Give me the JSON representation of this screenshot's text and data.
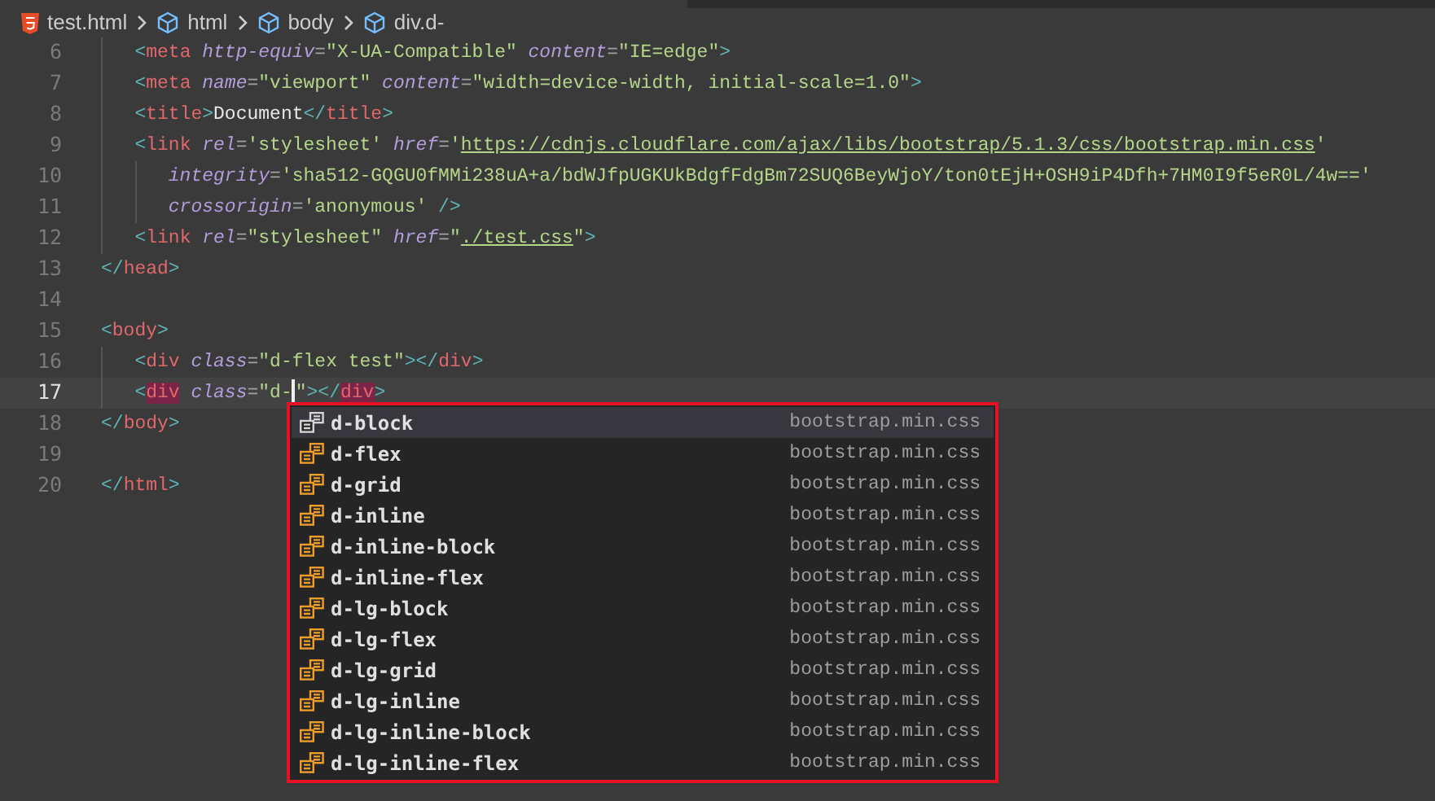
{
  "breadcrumb": [
    {
      "kind": "file",
      "label": "test.html"
    },
    {
      "kind": "element",
      "label": "html"
    },
    {
      "kind": "element",
      "label": "body"
    },
    {
      "kind": "element",
      "label": "div.d-"
    }
  ],
  "lines": [
    {
      "children": [
        {
          "number": "6",
          "current": false,
          "tokens": [
            {
              "kind": "bracket",
              "text": "<"
            },
            {
              "kind": "tag",
              "text": "meta"
            },
            {
              "kind": "attr",
              "text": " http-equiv"
            },
            {
              "kind": "eq",
              "text": "="
            },
            {
              "kind": "string",
              "text": "\"X-UA-Compatible\""
            },
            {
              "kind": "attr",
              "text": " content"
            },
            {
              "kind": "eq",
              "text": "="
            },
            {
              "kind": "string",
              "text": "\"IE=edge\""
            },
            {
              "kind": "bracket",
              "text": ">"
            }
          ]
        },
        {
          "number": "7",
          "current": false,
          "tokens": [
            {
              "kind": "bracket",
              "text": "<"
            },
            {
              "kind": "tag",
              "text": "meta"
            },
            {
              "kind": "attr",
              "text": " name"
            },
            {
              "kind": "eq",
              "text": "="
            },
            {
              "kind": "string",
              "text": "\"viewport\""
            },
            {
              "kind": "attr",
              "text": " content"
            },
            {
              "kind": "eq",
              "text": "="
            },
            {
              "kind": "string",
              "text": "\"width=device-width, initial-scale=1.0\""
            },
            {
              "kind": "bracket",
              "text": ">"
            }
          ]
        },
        {
          "number": "8",
          "current": false,
          "tokens": [
            {
              "kind": "bracket",
              "text": "<"
            },
            {
              "kind": "tag",
              "text": "title"
            },
            {
              "kind": "bracket",
              "text": ">"
            },
            {
              "kind": "text",
              "text": "Document"
            },
            {
              "kind": "bracket",
              "text": "</"
            },
            {
              "kind": "tag",
              "text": "title"
            },
            {
              "kind": "bracket",
              "text": ">"
            }
          ]
        },
        {
          "number": "9",
          "current": false,
          "tokens": [
            {
              "kind": "bracket",
              "text": "<"
            },
            {
              "kind": "tag",
              "text": "link"
            },
            {
              "kind": "attr",
              "text": " rel"
            },
            {
              "kind": "eq",
              "text": "="
            },
            {
              "kind": "string",
              "text": "'stylesheet'"
            },
            {
              "kind": "attr",
              "text": " href"
            },
            {
              "kind": "eq",
              "text": "="
            },
            {
              "kind": "string",
              "text": "'"
            },
            {
              "kind": "link",
              "text": "https://cdnjs.cloudflare.com/ajax/libs/bootstrap/5.1.3/css/bootstrap.min.css"
            },
            {
              "kind": "string",
              "text": "'"
            }
          ],
          "children": [
            {
              "number": "10",
              "current": false,
              "tokens": [
                {
                  "kind": "attr",
                  "text": "integrity"
                },
                {
                  "kind": "eq",
                  "text": "="
                },
                {
                  "kind": "string",
                  "text": "'sha512-GQGU0fMMi238uA+a/bdWJfpUGKUkBdgfFdgBm72SUQ6BeyWjoY/ton0tEjH+OSH9iP4Dfh+7HM0I9f5eR0L/4w=='"
                }
              ]
            },
            {
              "number": "11",
              "current": false,
              "tokens": [
                {
                  "kind": "attr",
                  "text": "crossorigin"
                },
                {
                  "kind": "eq",
                  "text": "="
                },
                {
                  "kind": "string",
                  "text": "'anonymous'"
                },
                {
                  "kind": "bracket",
                  "text": " />"
                }
              ]
            }
          ]
        },
        {
          "number": "12",
          "current": false,
          "tokens": [
            {
              "kind": "bracket",
              "text": "<"
            },
            {
              "kind": "tag",
              "text": "link"
            },
            {
              "kind": "attr",
              "text": " rel"
            },
            {
              "kind": "eq",
              "text": "="
            },
            {
              "kind": "string",
              "text": "\"stylesheet\""
            },
            {
              "kind": "attr",
              "text": " href"
            },
            {
              "kind": "eq",
              "text": "="
            },
            {
              "kind": "string",
              "text": "\""
            },
            {
              "kind": "link",
              "text": "./test.css"
            },
            {
              "kind": "string",
              "text": "\""
            },
            {
              "kind": "bracket",
              "text": ">"
            }
          ]
        }
      ]
    },
    {
      "number": "13",
      "current": false,
      "tokens": [
        {
          "kind": "bracket",
          "text": "</"
        },
        {
          "kind": "tag",
          "text": "head"
        },
        {
          "kind": "bracket",
          "text": ">"
        }
      ]
    },
    {
      "number": "14",
      "current": false
    },
    {
      "number": "15",
      "current": false,
      "tokens": [
        {
          "kind": "bracket",
          "text": "<"
        },
        {
          "kind": "tag",
          "text": "body"
        },
        {
          "kind": "bracket",
          "text": ">"
        }
      ],
      "children": [
        {
          "number": "16",
          "current": false,
          "tokens": [
            {
              "kind": "bracket",
              "text": "<"
            },
            {
              "kind": "tag",
              "text": "div"
            },
            {
              "kind": "attr",
              "text": " class"
            },
            {
              "kind": "eq",
              "text": "="
            },
            {
              "kind": "string",
              "text": "\"d-flex test\""
            },
            {
              "kind": "bracket",
              "text": "></"
            },
            {
              "kind": "tag",
              "text": "div"
            },
            {
              "kind": "bracket",
              "text": ">"
            }
          ]
        },
        {
          "number": "17",
          "current": true,
          "tokens": [
            {
              "kind": "bracket",
              "text": "<"
            },
            {
              "kind": "match",
              "text": "div"
            },
            {
              "kind": "attr",
              "text": " class"
            },
            {
              "kind": "eq",
              "text": "="
            },
            {
              "kind": "string",
              "text": "\"d-"
            },
            {
              "kind": "cursor"
            },
            {
              "kind": "string",
              "text": "\""
            },
            {
              "kind": "bracket",
              "text": "></"
            },
            {
              "kind": "match",
              "text": "div"
            },
            {
              "kind": "bracket",
              "text": ">"
            }
          ]
        }
      ]
    },
    {
      "number": "18",
      "current": false,
      "tokens": [
        {
          "kind": "bracket",
          "text": "</"
        },
        {
          "kind": "tag",
          "text": "body"
        },
        {
          "kind": "bracket",
          "text": ">"
        }
      ]
    },
    {
      "number": "19",
      "current": false
    },
    {
      "number": "20",
      "current": false,
      "tokens": [
        {
          "kind": "bracket",
          "text": "</"
        },
        {
          "kind": "tag",
          "text": "html"
        },
        {
          "kind": "bracket",
          "text": ">"
        }
      ]
    }
  ],
  "suggestions": [
    {
      "label": "d-block",
      "source": "bootstrap.min.css",
      "selected": true
    },
    {
      "label": "d-flex",
      "source": "bootstrap.min.css",
      "selected": false
    },
    {
      "label": "d-grid",
      "source": "bootstrap.min.css",
      "selected": false
    },
    {
      "label": "d-inline",
      "source": "bootstrap.min.css",
      "selected": false
    },
    {
      "label": "d-inline-block",
      "source": "bootstrap.min.css",
      "selected": false
    },
    {
      "label": "d-inline-flex",
      "source": "bootstrap.min.css",
      "selected": false
    },
    {
      "label": "d-lg-block",
      "source": "bootstrap.min.css",
      "selected": false
    },
    {
      "label": "d-lg-flex",
      "source": "bootstrap.min.css",
      "selected": false
    },
    {
      "label": "d-lg-grid",
      "source": "bootstrap.min.css",
      "selected": false
    },
    {
      "label": "d-lg-inline",
      "source": "bootstrap.min.css",
      "selected": false
    },
    {
      "label": "d-lg-inline-block",
      "source": "bootstrap.min.css",
      "selected": false
    },
    {
      "label": "d-lg-inline-flex",
      "source": "bootstrap.min.css",
      "selected": false
    }
  ]
}
